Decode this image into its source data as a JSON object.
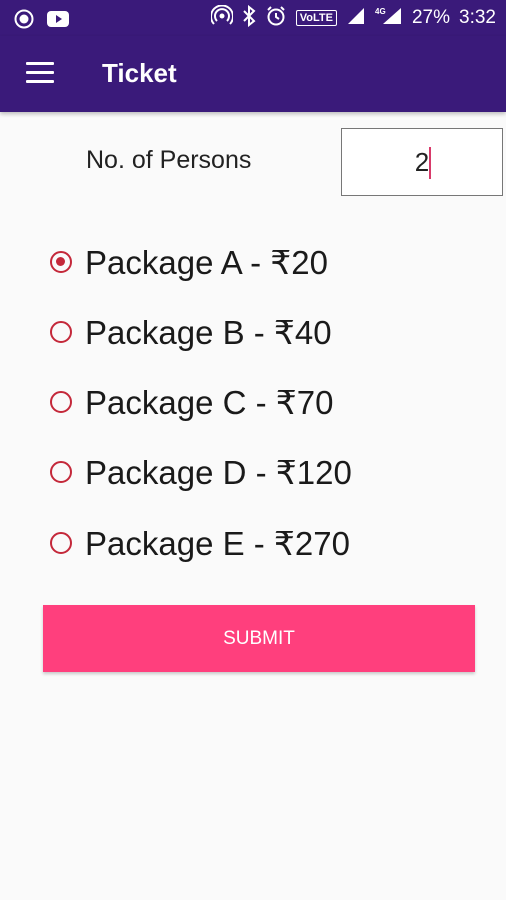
{
  "status_bar": {
    "left_icons": [
      "circle-icon",
      "youtube-icon"
    ],
    "right_icons": [
      "hotspot-icon",
      "bluetooth-icon",
      "alarm-icon",
      "volte-icon",
      "signal-icon",
      "4g-signal-icon"
    ],
    "volte_label": "VoLTE",
    "battery": "27%",
    "time": "3:32"
  },
  "app_bar": {
    "title": "Ticket",
    "menu_icon": "hamburger-menu-icon"
  },
  "form": {
    "persons_label": "No. of Persons",
    "persons_value": "2",
    "packages": [
      {
        "label": "Package A - ₹20",
        "checked": true
      },
      {
        "label": "Package B - ₹40",
        "checked": false
      },
      {
        "label": "Package C - ₹70",
        "checked": false
      },
      {
        "label": "Package D - ₹120",
        "checked": false
      },
      {
        "label": "Package E - ₹270",
        "checked": false
      }
    ],
    "submit_label": "SUBMIT"
  },
  "colors": {
    "app_bar": "#3a1a7a",
    "radio_accent": "#c4283a",
    "submit_button": "#ff3f7d"
  }
}
